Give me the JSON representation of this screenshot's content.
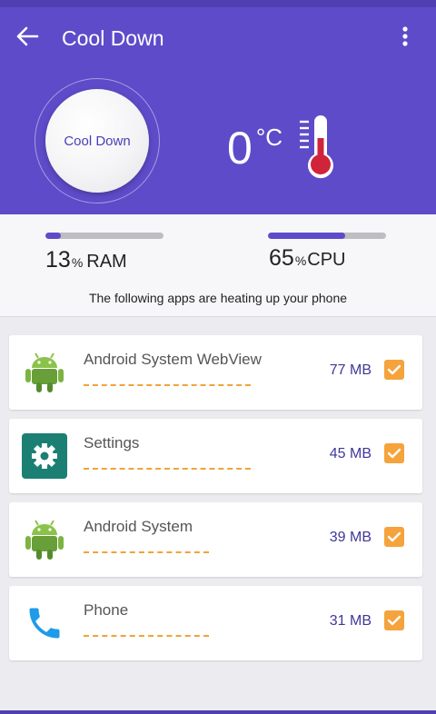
{
  "header": {
    "title": "Cool Down",
    "cool_button_label": "Cool Down",
    "temperature_value": "0",
    "temperature_unit": "°C"
  },
  "stats": {
    "ram": {
      "value": "13",
      "percent_sign": "%",
      "label": "RAM",
      "percent": 13
    },
    "cpu": {
      "value": "65",
      "percent_sign": "%",
      "label": "CPU",
      "percent": 65
    },
    "notice": "The following apps are heating up your phone"
  },
  "apps": [
    {
      "name": "Android System WebView",
      "size": "77 MB",
      "icon": "android-icon",
      "checked": true
    },
    {
      "name": "Settings",
      "size": "45 MB",
      "icon": "settings-gear-icon",
      "checked": true
    },
    {
      "name": "Android System",
      "size": "39 MB",
      "icon": "android-icon",
      "checked": true
    },
    {
      "name": "Phone",
      "size": "31 MB",
      "icon": "phone-icon",
      "checked": true
    }
  ],
  "colors": {
    "header_bg": "#5e4bc9",
    "accent_check": "#f5a33c",
    "size_text": "#3f3899",
    "thermometer_red": "#d0243a"
  }
}
